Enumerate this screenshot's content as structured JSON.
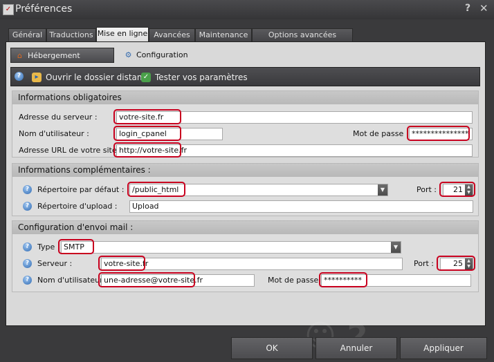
{
  "window": {
    "title": "Préférences",
    "help": "?",
    "close": "✕"
  },
  "tabs": [
    {
      "label": "Général"
    },
    {
      "label": "Traductions"
    },
    {
      "label": "Mise en ligne"
    },
    {
      "label": "Avancées"
    },
    {
      "label": "Maintenance"
    },
    {
      "label": "Options avancées (expert)"
    }
  ],
  "subtabs": [
    {
      "label": "Hébergement partenaire"
    },
    {
      "label": "Configuration"
    }
  ],
  "toolbar": {
    "open_remote": "Ouvrir le dossier distant",
    "test_settings": "Tester vos paramètres"
  },
  "required": {
    "title": "Informations obligatoires",
    "server_label": "Adresse du serveur :",
    "server_value": "votre-site.fr",
    "user_label": "Nom d'utilisateur :",
    "user_value": "login_cpanel",
    "password_label": "Mot de passe :",
    "password_value": "***************",
    "url_label": "Adresse URL de votre site :",
    "url_value": "http://votre-site.fr"
  },
  "extra": {
    "title": "Informations complémentaires :",
    "dir_label": "Répertoire par défaut :",
    "dir_value": "/public_html",
    "port_label": "Port :",
    "port_value": "21",
    "upload_label": "Répertoire d'upload :",
    "upload_value": "Upload"
  },
  "mail": {
    "title": "Configuration d'envoi mail :",
    "type_label": "Type :",
    "type_value": "SMTP",
    "server_label": "Serveur :",
    "server_value": "votre-site.fr",
    "port_label": "Port :",
    "port_value": "25",
    "user_label": "Nom d'utilisateur :",
    "user_value": "une-adresse@votre-site.fr",
    "password_label": "Mot de passe :",
    "password_value": "**********"
  },
  "buttons": {
    "ok": "OK",
    "cancel": "Annuler",
    "apply": "Appliquer"
  },
  "colors": {
    "highlight": "#c8001e",
    "dark_chrome": "#3a3a3c",
    "panel": "#d9d9d9"
  },
  "icons": [
    "app-icon",
    "help-icon",
    "home-icon",
    "gear-icon",
    "folder-icon",
    "shield-check-icon",
    "dropdown-arrow-icon",
    "spinner-icon"
  ]
}
